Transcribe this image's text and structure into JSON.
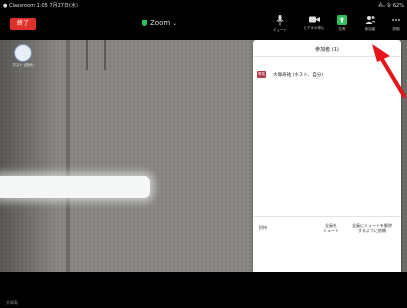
{
  "status": {
    "left": "● Classroom  1:05  7月27日(水)",
    "right": "⁂ᵢₗ 令 62%"
  },
  "toolbar": {
    "end_label": "終了",
    "title": "Zoom",
    "mic_label": "ミュート",
    "video_label": "ビデオの停止",
    "share_label": "共有",
    "participants_label": "参加者",
    "more_label": "詳細"
  },
  "self_view": {
    "name": "ホスト (自分)"
  },
  "panel": {
    "title": "参加者 (1)",
    "participants": [
      {
        "initials": "寿祐",
        "name": "大塚寿祐 (ホスト、自分)"
      }
    ],
    "invite_label": "招待",
    "mute_all_label_1": "全員を",
    "mute_all_label_2": "ミュート",
    "unmute_label_1": "全員にミュートを解除",
    "unmute_label_2": "するように依頼"
  },
  "bottom": {
    "text": "大塚寿"
  },
  "colors": {
    "end_red": "#e0312b",
    "share_green": "#2bc15a",
    "arrow_red": "#e8131b"
  }
}
